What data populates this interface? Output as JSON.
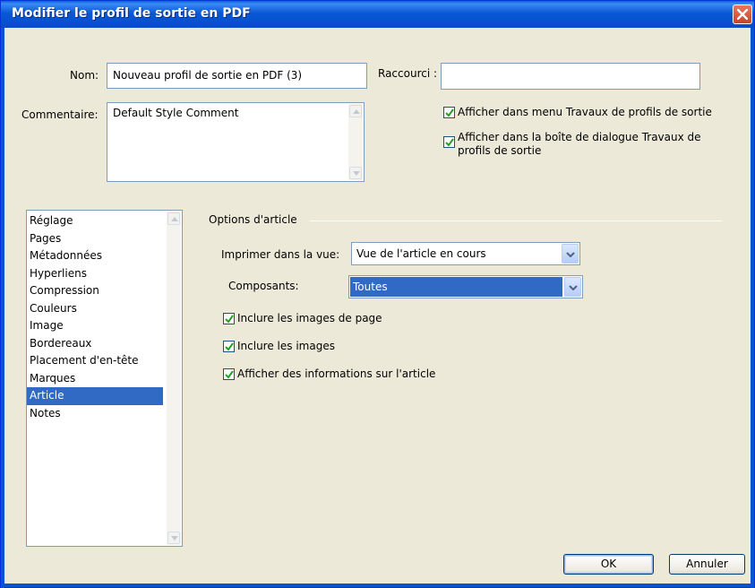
{
  "window": {
    "title": "Modifier le profil de sortie en PDF",
    "close_label": "close"
  },
  "form": {
    "name_label": "Nom:",
    "name_value": "Nouveau profil de sortie en PDF (3)",
    "shortcut_label": "Raccourci :",
    "shortcut_value": "",
    "comment_label": "Commentaire:",
    "comment_value": "Default Style Comment",
    "show_in_menu": {
      "label": "Afficher dans menu Travaux de profils de sortie",
      "checked": true
    },
    "show_in_dialog": {
      "label": "Afficher dans la boîte de dialogue Travaux de profils de sortie",
      "checked": true
    }
  },
  "categories": {
    "items": [
      "Réglage",
      "Pages",
      "Métadonnées",
      "Hyperliens",
      "Compression",
      "Couleurs",
      "Image",
      "Bordereaux",
      "Placement d'en-tête",
      "Marques",
      "Article",
      "Notes"
    ],
    "selected": "Article"
  },
  "article_options": {
    "group_title": "Options d'article",
    "print_in_view_label": "Imprimer dans la vue:",
    "print_in_view_value": "Vue de l'article en cours",
    "components_label": "Composants:",
    "components_value": "Toutes",
    "include_page_images": {
      "label": "Inclure les images de page",
      "checked": true
    },
    "include_images": {
      "label": "Inclure les images",
      "checked": true
    },
    "show_article_info": {
      "label": "Afficher des informations sur l'article",
      "checked": true
    }
  },
  "buttons": {
    "ok": "OK",
    "cancel": "Annuler"
  },
  "colors": {
    "titlebar": "#0a58d6",
    "selection": "#316ac5",
    "dialog_bg": "#ece9d8",
    "close_button": "#c8432a"
  }
}
